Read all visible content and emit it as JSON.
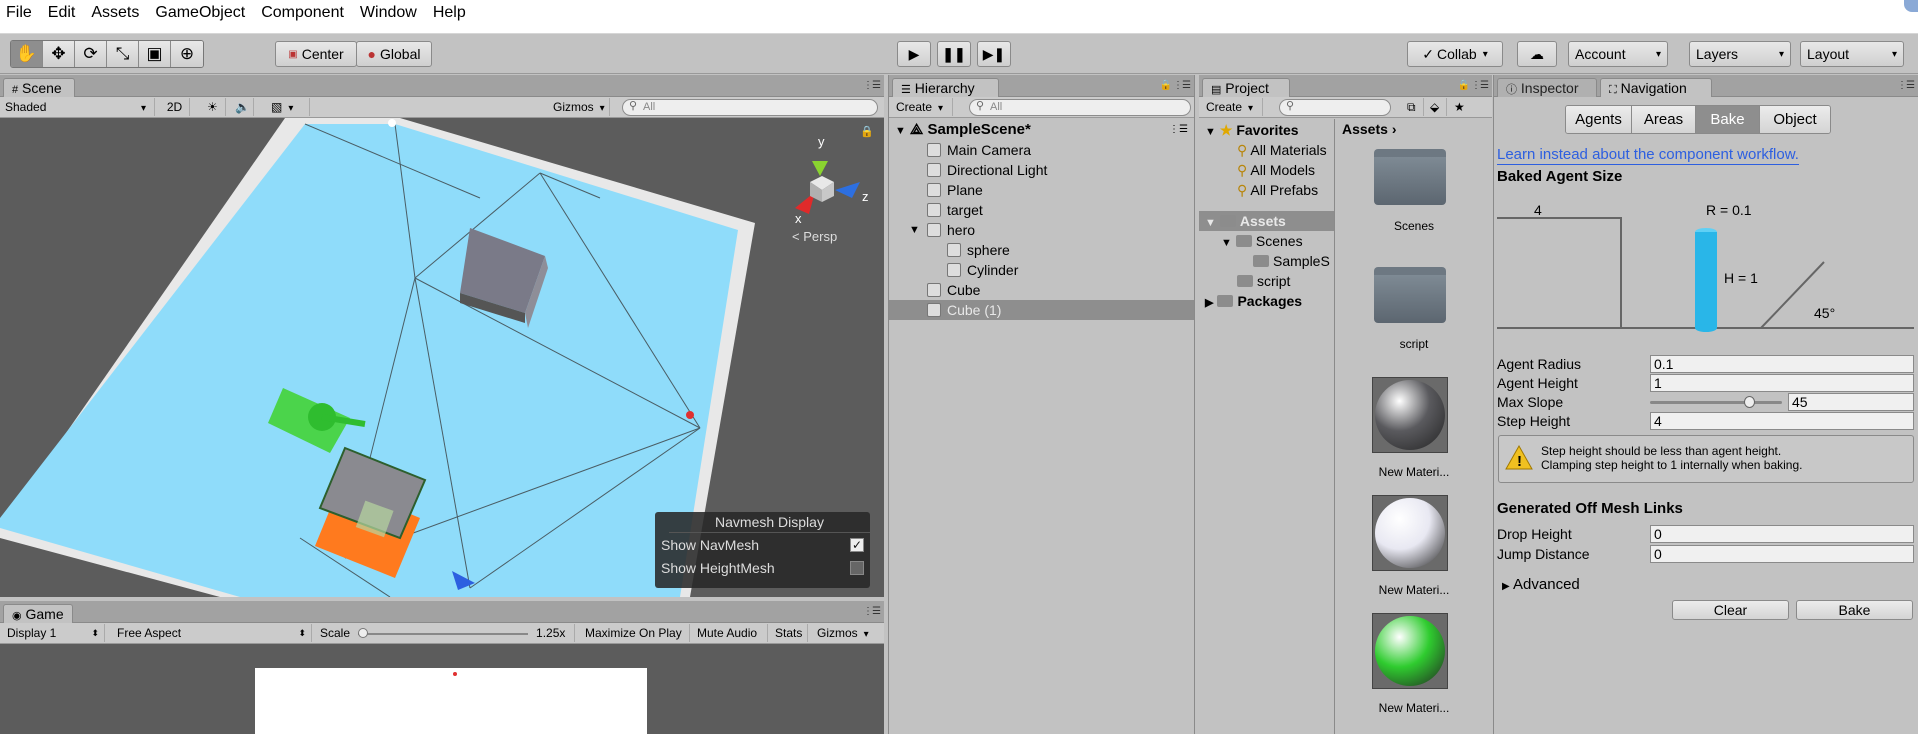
{
  "menu": [
    "File",
    "Edit",
    "Assets",
    "GameObject",
    "Component",
    "Window",
    "Help"
  ],
  "toolbar": {
    "pivot": "Center",
    "space": "Global",
    "collab": "Collab",
    "account": "Account",
    "layers": "Layers",
    "layout": "Layout"
  },
  "scene": {
    "tab": "Scene",
    "shading": "Shaded",
    "mode2d": "2D",
    "gizmos": "Gizmos",
    "search_placeholder": "All",
    "persp": "Persp",
    "axes": {
      "x": "x",
      "y": "y",
      "z": "z"
    },
    "navmesh_display": {
      "title": "Navmesh Display",
      "show_navmesh": "Show NavMesh",
      "show_navmesh_checked": true,
      "show_heightmesh": "Show HeightMesh",
      "show_heightmesh_checked": false
    }
  },
  "game": {
    "tab": "Game",
    "display": "Display 1",
    "aspect": "Free Aspect",
    "scale_label": "Scale",
    "scale_value": "1.25x",
    "maximize": "Maximize On Play",
    "mute": "Mute Audio",
    "stats": "Stats",
    "gizmos": "Gizmos"
  },
  "hierarchy": {
    "tab": "Hierarchy",
    "create": "Create",
    "search_placeholder": "All",
    "scene": "SampleScene*",
    "items": [
      {
        "label": "Main Camera",
        "depth": 1,
        "selected": false
      },
      {
        "label": "Directional Light",
        "depth": 1,
        "selected": false
      },
      {
        "label": "Plane",
        "depth": 1,
        "selected": false
      },
      {
        "label": "target",
        "depth": 1,
        "selected": false
      },
      {
        "label": "hero",
        "depth": 1,
        "selected": false,
        "expanded": true
      },
      {
        "label": "sphere",
        "depth": 2,
        "selected": false
      },
      {
        "label": "Cylinder",
        "depth": 2,
        "selected": false
      },
      {
        "label": "Cube",
        "depth": 1,
        "selected": false
      },
      {
        "label": "Cube (1)",
        "depth": 1,
        "selected": true
      }
    ]
  },
  "project": {
    "tab": "Project",
    "create": "Create",
    "favorites": "Favorites",
    "fav_items": [
      "All Materials",
      "All Models",
      "All Prefabs"
    ],
    "tree": {
      "assets": "Assets",
      "scenes": "Scenes",
      "sample": "SampleS",
      "script": "script",
      "packages": "Packages"
    },
    "breadcrumb": "Assets",
    "assets": [
      {
        "label": "Scenes",
        "kind": "folder"
      },
      {
        "label": "script",
        "kind": "folder"
      },
      {
        "label": "New Materi...",
        "kind": "sphere",
        "color": "#5a5a5e"
      },
      {
        "label": "New Materi...",
        "kind": "sphere",
        "color": "#e8e8f2"
      },
      {
        "label": "New Materi...",
        "kind": "sphere",
        "color": "#2fcc2f"
      }
    ]
  },
  "inspector": {
    "tab_inspector": "Inspector",
    "tab_navigation": "Navigation",
    "nav_tabs": [
      "Agents",
      "Areas",
      "Bake",
      "Object"
    ],
    "active_tab": "Bake",
    "link": "Learn instead about the component workflow.",
    "baked_agent_size": "Baked Agent Size",
    "diagram": {
      "step": "4",
      "radius": "R = 0.1",
      "height": "H = 1",
      "slope": "45°"
    },
    "fields": [
      {
        "label": "Agent Radius",
        "value": "0.1"
      },
      {
        "label": "Agent Height",
        "value": "1"
      },
      {
        "label": "Max Slope",
        "value": "45",
        "slider_fraction": 0.75
      },
      {
        "label": "Step Height",
        "value": "4"
      }
    ],
    "warning": [
      "Step height should be less than agent height.",
      "Clamping step height to 1 internally when baking."
    ],
    "off_mesh_title": "Generated Off Mesh Links",
    "off_mesh_fields": [
      {
        "label": "Drop Height",
        "value": "0"
      },
      {
        "label": "Jump Distance",
        "value": "0"
      }
    ],
    "advanced": "Advanced",
    "clear": "Clear",
    "bake": "Bake"
  },
  "colors": {
    "navmesh": "#8fdcfa",
    "link": "#2d5fe0",
    "selection": "#3d78e0"
  }
}
